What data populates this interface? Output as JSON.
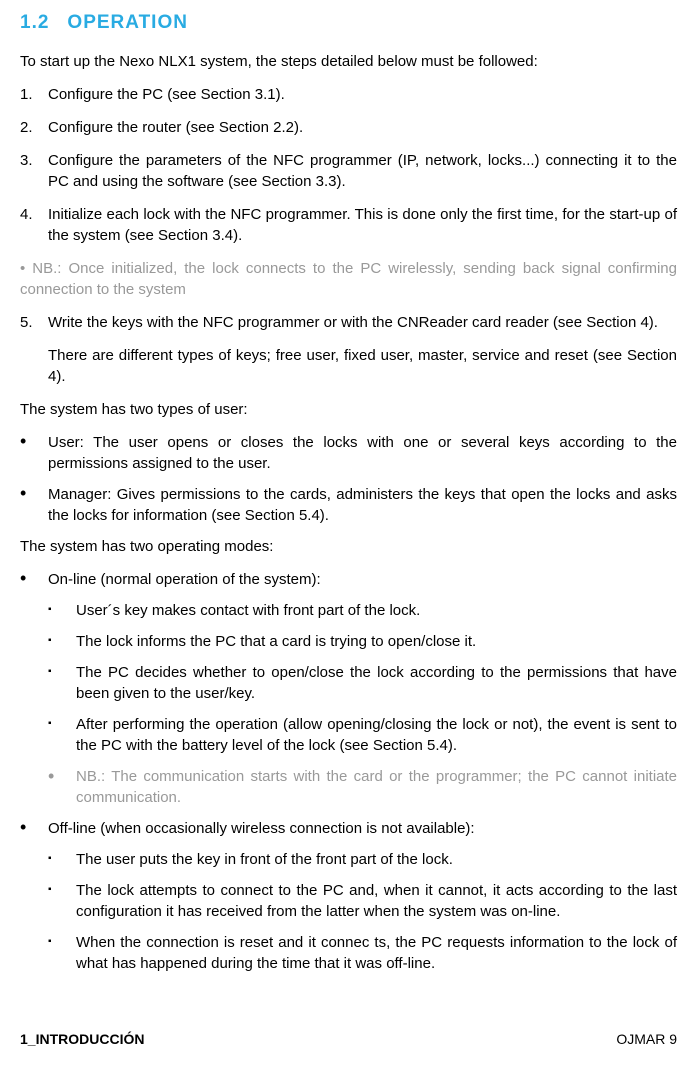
{
  "heading": {
    "number": "1.2",
    "title": "OPERATION"
  },
  "intro": "To start up the Nexo NLX1 system, the steps detailed below must be followed:",
  "steps": [
    {
      "n": "1.",
      "text": "Configure the PC (see Section 3.1)."
    },
    {
      "n": "2.",
      "text": "Configure the router (see Section 2.2)."
    },
    {
      "n": "3.",
      "text": "Configure the parameters of the NFC programmer (IP, network, locks...) connecting it to the PC and using the software (see Section 3.3)."
    },
    {
      "n": "4.",
      "text": "Initialize each lock with the NFC programmer. This is done only the first time, for the start-up of the system (see Section 3.4)."
    }
  ],
  "note1_prefix": "• NB.: ",
  "note1": "Once initialized, the lock connects to the PC wirelessly, sending back signal confirming connection to the system",
  "step5": {
    "n": "5.",
    "text": "Write the keys with the NFC programmer or with the CNReader card reader (see Section 4).",
    "extra": "There are different types of keys; free user, fixed user, master, service and reset (see Section 4)."
  },
  "users_intro": "The system has two types of user:",
  "users": [
    "User: The user opens or closes the locks with one or several keys according to the permissions assigned to the user.",
    "Manager: Gives permissions to the cards, administers the keys that open the locks and asks the locks for information (see Section 5.4)."
  ],
  "modes_intro": "The system has two operating modes:",
  "online_title": "On-line (normal operation of the system):",
  "online_items": [
    "User´s key makes contact with front part of the lock.",
    "The lock informs the PC that a card is trying to open/close it.",
    "The PC decides whether to open/close the lock according to the permissions that have been given to the user/key.",
    "After performing the operation (allow opening/closing the lock or not), the event is sent to the PC with the battery level of the lock (see Section 5.4)."
  ],
  "online_note": "NB.: The communication starts with the card or the programmer; the PC cannot initiate communication.",
  "offline_title": "Off-line (when occasionally wireless connection is not available):",
  "offline_items": [
    "The user puts the key in front of the front part of the lock.",
    "The lock attempts to connect to the PC and, when it cannot, it acts according to the last configuration it has received from the latter when the system was on-line.",
    "When the connection is reset and it connec ts, the PC requests information to the lock of what has happened during the time that it was off-line."
  ],
  "footer": {
    "left": "1_INTRODUCCIÓN",
    "right": "OJMAR 9"
  }
}
